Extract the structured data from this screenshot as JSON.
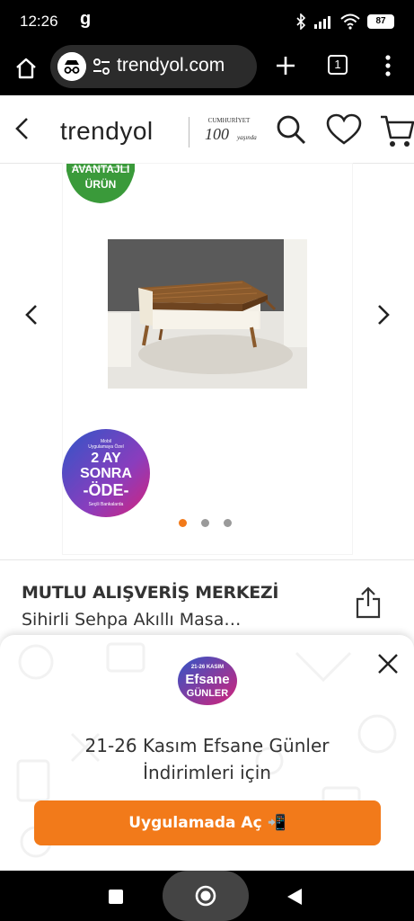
{
  "status_bar": {
    "time": "12:26",
    "carrier_glyph": "g",
    "battery": "87",
    "icons": [
      "bluetooth-icon",
      "signal-icon",
      "wifi-icon",
      "battery-icon"
    ]
  },
  "browser": {
    "url": "trendyol.com",
    "tab_count": "1"
  },
  "header": {
    "logo": "trendyol",
    "badge_top": "CUMHURİYET",
    "badge_number": "100",
    "badge_sub": "yaşında"
  },
  "gallery": {
    "badge_top": "AVANTAJLI",
    "badge_bottom": "ÜRÜN",
    "ay_small_1": "Mobil",
    "ay_small_2": "Uygulamaya Özel",
    "ay_line1": "2 AY",
    "ay_line2": "SONRA",
    "ay_line3": "-ÖDE-",
    "ay_small_bottom": "Seçili Bankalarda",
    "image_count": 3,
    "active_index": 0
  },
  "product": {
    "brand": "MUTLU ALIŞVERİŞ MERKEZİ",
    "name": "Sihirli Sehpa Akıllı Masa…"
  },
  "promo": {
    "badge_top": "21-26 KASIM",
    "badge_main": "Efsane",
    "badge_sub": "GÜNLER",
    "text_line1": "21-26 Kasım Efsane Günler",
    "text_line2": "İndirimleri için",
    "button_label": "Uygulamada Aç 📲"
  },
  "colors": {
    "brand_orange": "#f27a1a",
    "badge_green": "#3a9a3a",
    "badge_pink": "#d4237a"
  }
}
